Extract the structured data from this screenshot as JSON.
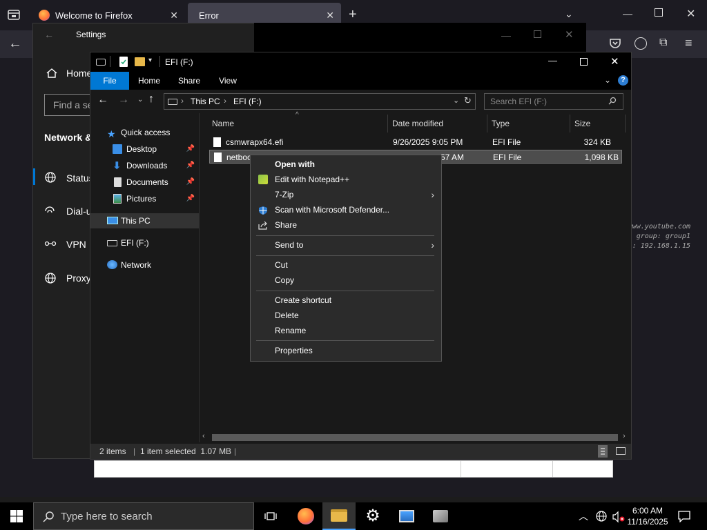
{
  "firefox": {
    "tabs": [
      {
        "title": "Welcome to Firefox"
      },
      {
        "title": "Error"
      }
    ],
    "log_lines": [
      "www.youtube.com",
      "group: group1",
      "/: 192.168.1.15"
    ]
  },
  "settings": {
    "title": "Settings",
    "home_label": "Home",
    "find_placeholder": "Find a se",
    "section_label": "Network &",
    "nav": [
      "Status",
      "Dial-u",
      "VPN",
      "Proxy"
    ]
  },
  "explorer": {
    "title": "EFI (F:)",
    "ribbon_tabs": [
      "File",
      "Home",
      "Share",
      "View"
    ],
    "breadcrumb": [
      "This PC",
      "EFI (F:)"
    ],
    "search_placeholder": "Search EFI (F:)",
    "nav_pane": {
      "quick_access": "Quick access",
      "items": [
        "Desktop",
        "Downloads",
        "Documents",
        "Pictures"
      ],
      "this_pc": "This PC",
      "drive": "EFI (F:)",
      "network": "Network"
    },
    "columns": [
      "Name",
      "Date modified",
      "Type",
      "Size"
    ],
    "files": [
      {
        "name": "csmwrapx64.efi",
        "date": "9/26/2025 9:05 PM",
        "type": "EFI File",
        "size": "324 KB"
      },
      {
        "name": "netboo",
        "date": "57 AM",
        "type": "EFI File",
        "size": "1,098 KB"
      }
    ],
    "status": {
      "items": "2 items",
      "selected": "1 item selected  1.07 MB"
    }
  },
  "context_menu": {
    "open_with": "Open with",
    "edit_notepad": "Edit with Notepad++",
    "seven_zip": "7-Zip",
    "scan_defender": "Scan with Microsoft Defender...",
    "share": "Share",
    "send_to": "Send to",
    "cut": "Cut",
    "copy": "Copy",
    "create_shortcut": "Create shortcut",
    "delete": "Delete",
    "rename": "Rename",
    "properties": "Properties"
  },
  "taskbar": {
    "search_placeholder": "Type here to search",
    "time": "6:00 AM",
    "date": "11/16/2025"
  },
  "colors": {
    "accent": "#0078d4",
    "selection": "#4d4d4d",
    "firefox_orange": "#ff7139",
    "folder_yellow": "#e8b84a"
  }
}
